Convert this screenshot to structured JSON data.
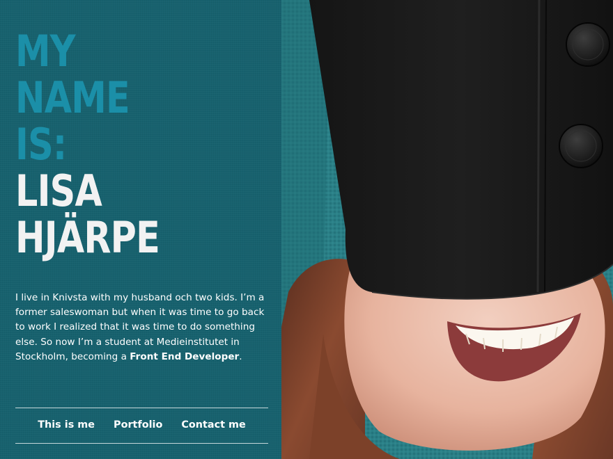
{
  "heading": {
    "intro_lines": [
      "MY",
      "NAME",
      "IS:"
    ],
    "name_lines": [
      "LISA",
      "HJÄRPE"
    ]
  },
  "bio": {
    "text": "I live in Knivsta with my husband och two kids. I’m a former saleswoman but when it was time to  go back to work I realized that it was time to do something else. So now I’m a student at Medieinstitutet in Stockholm, becoming a ",
    "highlight": "Front End Developer",
    "end": "."
  },
  "nav": {
    "items": [
      "This is me",
      "Portfolio",
      "Contact me"
    ]
  },
  "photo": {
    "subject": "smiling woman wearing black hat pulled over her eyes"
  },
  "colors": {
    "panel_background": "#17616e",
    "heading_accent": "#1b8fa8",
    "heading_name": "#f2f2f2",
    "text": "#ffffff"
  }
}
